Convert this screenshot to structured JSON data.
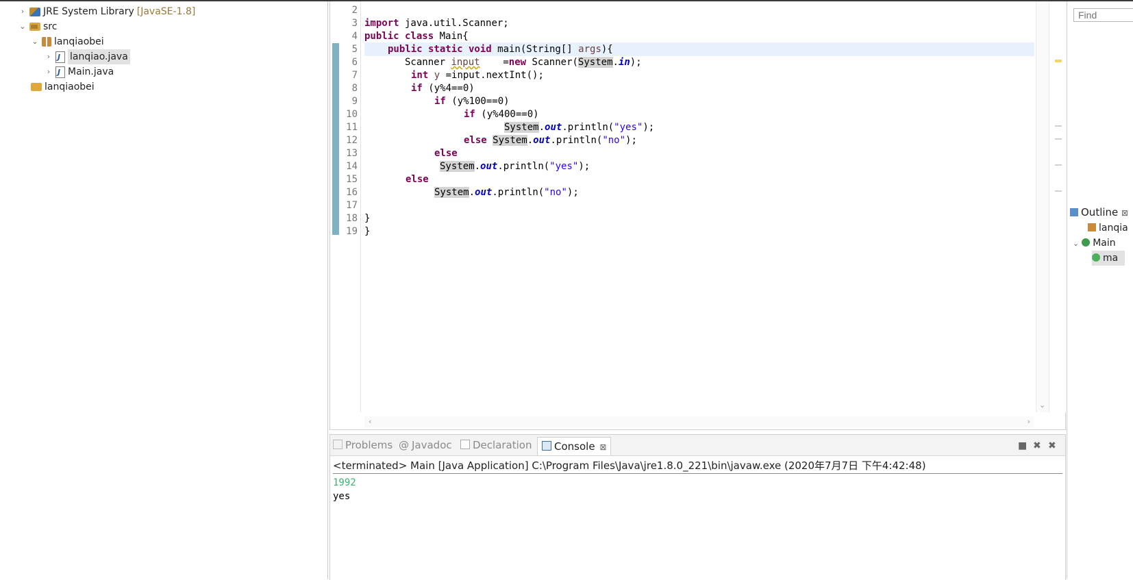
{
  "tree": {
    "items": [
      {
        "label": "JRE System Library",
        "suffix": "[JavaSE-1.8]"
      },
      {
        "label": "src"
      },
      {
        "label": "lanqiaobei"
      },
      {
        "label": "lanqiao.java"
      },
      {
        "label": "Main.java"
      },
      {
        "label": "lanqiaobei"
      }
    ]
  },
  "editor": {
    "line_numbers": [
      "2",
      "3",
      "4",
      "5",
      "6",
      "7",
      "8",
      "9",
      "10",
      "11",
      "12",
      "13",
      "14",
      "15",
      "16",
      "17",
      "18",
      "19"
    ],
    "code": {
      "l3_kw": "import",
      "l3_rest": " java.util.Scanner;",
      "l4_kw": "public class",
      "l4_rest": " Main{",
      "l5_kw": "public static void",
      "l5_name": " main(String[] ",
      "l5_var": "args",
      "l5_end": "){",
      "l6_type": "Scanner",
      "l6_var": "input",
      "l6_eq": "    =",
      "l6_kw": "new",
      "l6_mid": " Scanner(",
      "l6_sys": "System",
      "l6_dot": ".",
      "l6_fld": "in",
      "l6_end": ");",
      "l7_kw": "int",
      "l7_var": " y ",
      "l7_rest": "=input.nextInt();",
      "l8_kw": "if",
      "l8_rest": " (y%4==0)",
      "l9_kw": "if",
      "l9_rest": " (y%100==0)",
      "l10_kw": "if",
      "l10_rest": " (y%400==0)",
      "sys": "System",
      "dot": ".",
      "out": "out",
      "println": ".println(",
      "str_yes": "\"yes\"",
      "str_no": "\"no\"",
      "end": ");",
      "else": "else",
      "brace": "}"
    }
  },
  "right": {
    "find_placeholder": "Find",
    "outline_label": "Outline",
    "outline_close": "⊠",
    "outline_items": [
      "lanqia",
      "Main",
      "ma"
    ]
  },
  "console": {
    "tabs": [
      "Problems",
      "Javadoc",
      "Declaration",
      "Console"
    ],
    "close_glyph": "⊠",
    "terminated": "<terminated> Main [Java Application] C:\\Program Files\\Java\\jre1.8.0_221\\bin\\javaw.exe (2020年7月7日 下午4:42:48)",
    "input_echo": "1992",
    "output": "yes"
  },
  "colors": {
    "keyword": "#7f0055",
    "field": "#0000c0",
    "string": "#2a00ff",
    "input_echo": "#3cb371"
  }
}
